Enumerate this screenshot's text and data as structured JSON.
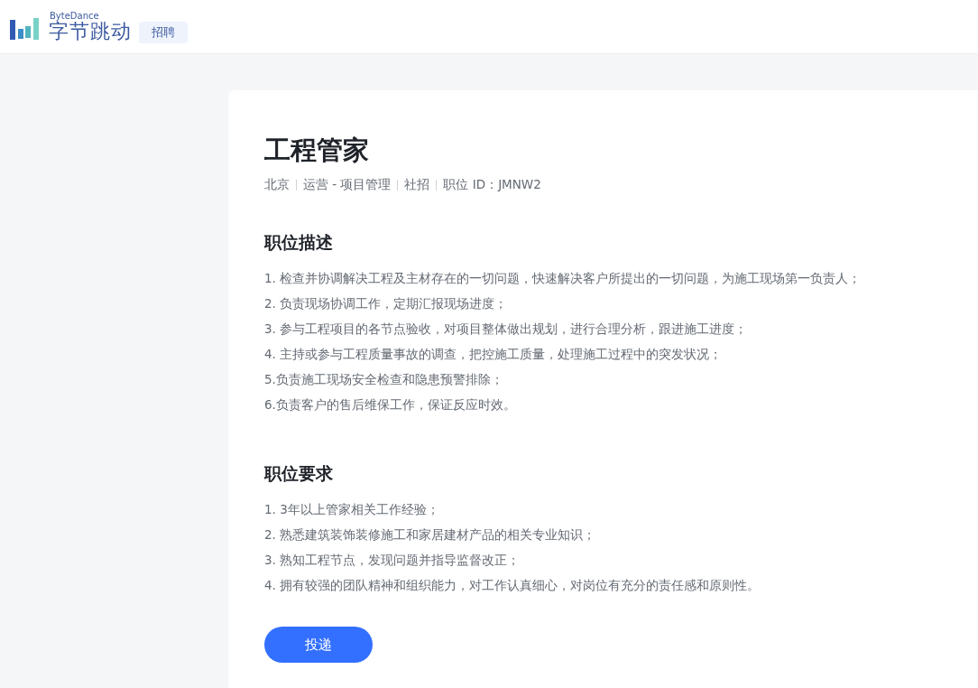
{
  "header": {
    "brand_en": "ByteDance",
    "brand_cn": "字节跳动",
    "tag": "招聘"
  },
  "job": {
    "title": "工程管家",
    "meta": [
      "北京",
      "运营 - 项目管理",
      "社招",
      "职位 ID：JMNW2"
    ],
    "sections": [
      {
        "heading": "职位描述",
        "lines": [
          "1. 检查并协调解决工程及主材存在的一切问题，快速解决客户所提出的一切问题，为施工现场第一负责人；",
          "2. 负责现场协调工作，定期汇报现场进度；",
          "3. 参与工程项目的各节点验收，对项目整体做出规划，进行合理分析，跟进施工进度；",
          "4. 主持或参与工程质量事故的调查，把控施工质量，处理施工过程中的突发状况；",
          "5.负责施工现场安全检查和隐患预警排除；",
          "6.负责客户的售后维保工作，保证反应时效。"
        ]
      },
      {
        "heading": "职位要求",
        "lines": [
          "1. 3年以上管家相关工作经验；",
          "2. 熟悉建筑装饰装修施工和家居建材产品的相关专业知识；",
          "3. 熟知工程节点，发现问题并指导监督改正；",
          "4. 拥有较强的团队精神和组织能力，对工作认真细心，对岗位有充分的责任感和原则性。"
        ]
      }
    ],
    "apply_button": "投递"
  }
}
